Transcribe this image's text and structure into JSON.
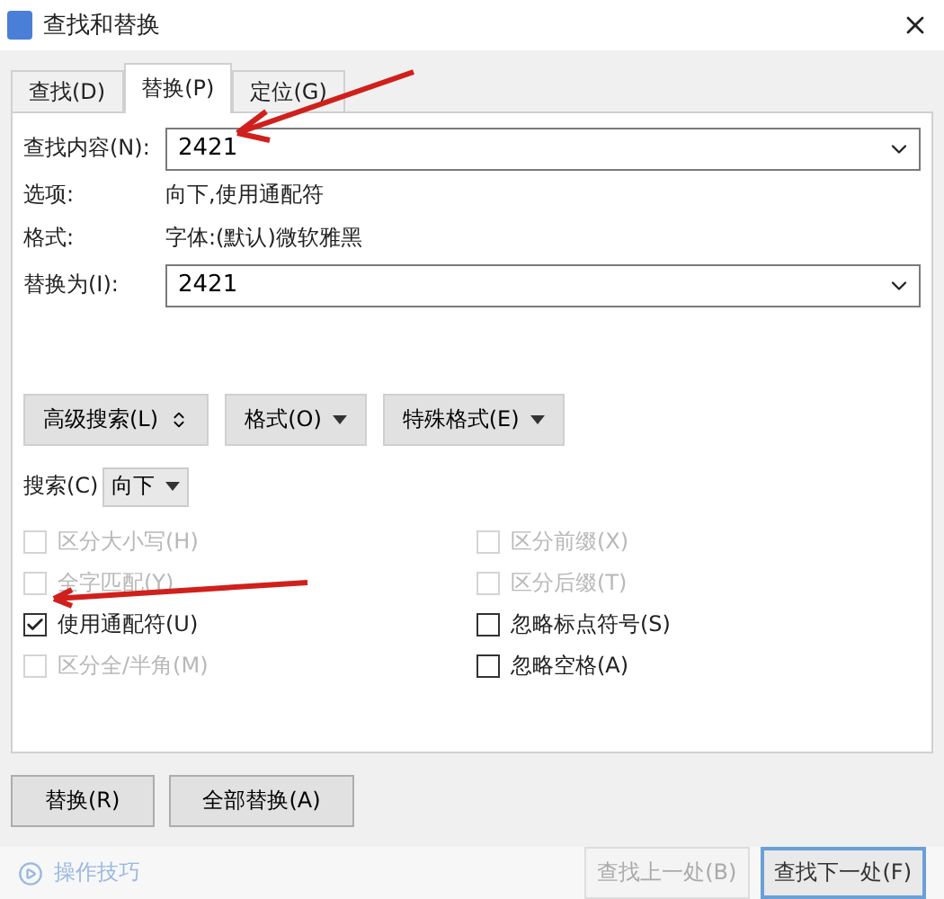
{
  "window": {
    "title": "查找和替换"
  },
  "tabs": [
    {
      "label": "查找(D)",
      "selected": false
    },
    {
      "label": "替换(P)",
      "selected": true
    },
    {
      "label": "定位(G)",
      "selected": false
    }
  ],
  "find": {
    "label": "查找内容(N):",
    "value": "2421"
  },
  "info": [
    {
      "label": "选项:",
      "value": "向下,使用通配符"
    },
    {
      "label": "格式:",
      "value": "字体:(默认)微软雅黑"
    }
  ],
  "replace": {
    "label": "替换为(I):",
    "value": "2421"
  },
  "tool_buttons": [
    {
      "label": "高级搜索(L)",
      "kind": "expand"
    },
    {
      "label": "格式(O)",
      "kind": "menu"
    },
    {
      "label": "特殊格式(E)",
      "kind": "menu"
    }
  ],
  "search": {
    "label": "搜索(C)",
    "value": "向下"
  },
  "checkbox_columns": [
    [
      {
        "label": "区分大小写(H)",
        "checked": false,
        "disabled": true
      },
      {
        "label": "全字匹配(Y)",
        "checked": false,
        "disabled": true
      },
      {
        "label": "使用通配符(U)",
        "checked": true,
        "disabled": false
      },
      {
        "label": "区分全/半角(M)",
        "checked": false,
        "disabled": true
      }
    ],
    [
      {
        "label": "区分前缀(X)",
        "checked": false,
        "disabled": true
      },
      {
        "label": "区分后缀(T)",
        "checked": false,
        "disabled": true
      },
      {
        "label": "忽略标点符号(S)",
        "checked": false,
        "disabled": false
      },
      {
        "label": "忽略空格(A)",
        "checked": false,
        "disabled": false
      }
    ]
  ],
  "action_buttons": [
    "替换(R)",
    "全部替换(A)"
  ],
  "footer": {
    "link": "操作技巧",
    "buttons": [
      {
        "label": "查找上一处(B)",
        "disabled": true,
        "default": false
      },
      {
        "label": "查找下一处(F)",
        "disabled": false,
        "default": true
      }
    ]
  }
}
